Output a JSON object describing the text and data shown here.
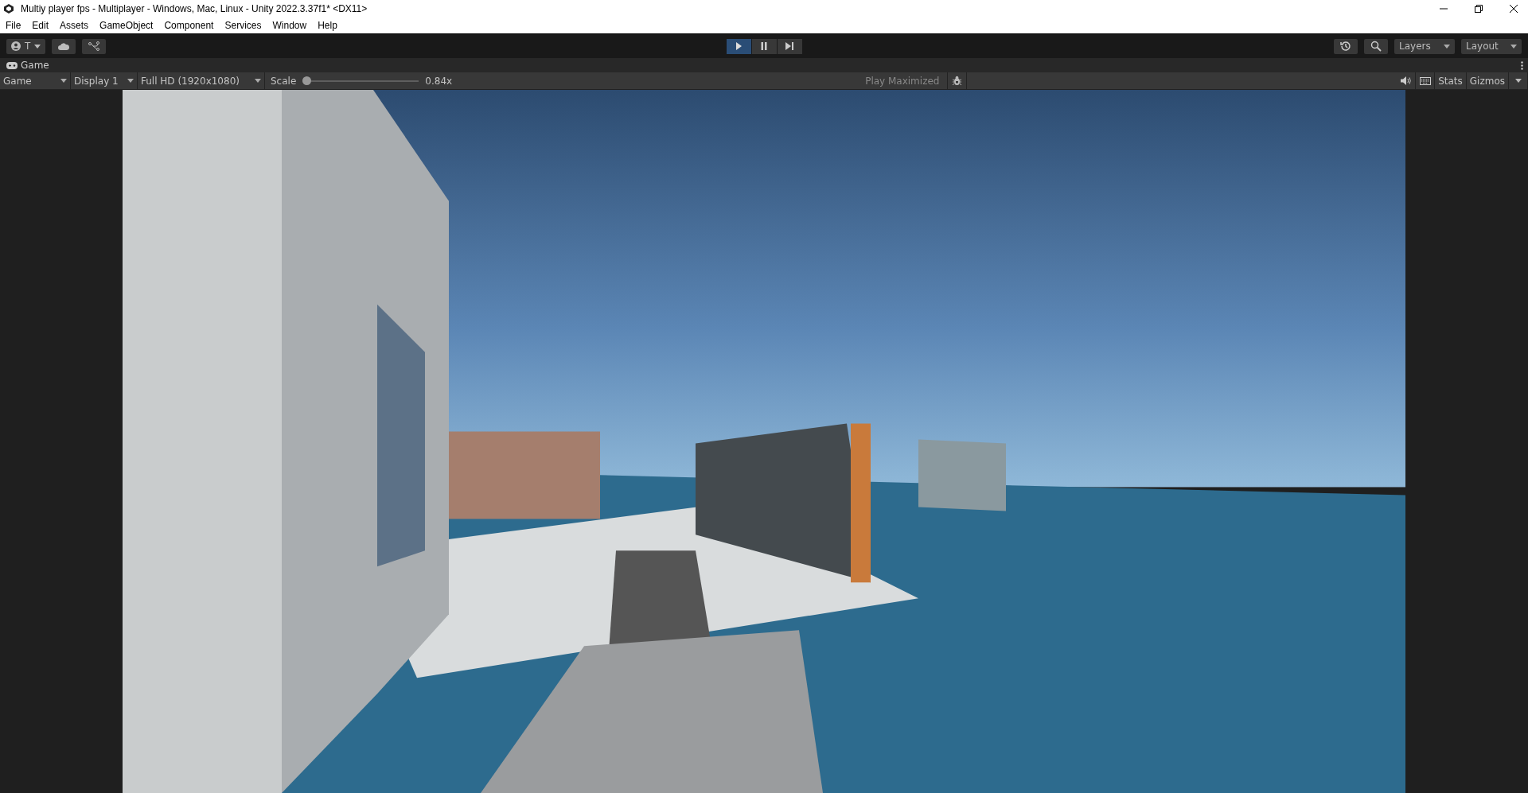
{
  "window": {
    "title": "Multiy player fps - Multiplayer - Windows, Mac, Linux - Unity 2022.3.37f1* <DX11>"
  },
  "menu": [
    "File",
    "Edit",
    "Assets",
    "GameObject",
    "Component",
    "Services",
    "Window",
    "Help"
  ],
  "toolbar": {
    "account": "T",
    "playback": [
      {
        "kind": "play",
        "on": true
      },
      {
        "kind": "pause",
        "on": false
      },
      {
        "kind": "step",
        "on": false
      }
    ],
    "layers": "Layers",
    "layout": "Layout"
  },
  "panel_tab": {
    "label": "Game"
  },
  "game_toolbar": {
    "view": "Game",
    "display": "Display 1",
    "resolution": "Full HD (1920x1080)",
    "scale_label": "Scale",
    "scale": {
      "level": 0.02
    },
    "scale_reading": "0.84x",
    "play_mode": "Play Maximized",
    "stats": "Stats",
    "gizmos": "Gizmos"
  }
}
